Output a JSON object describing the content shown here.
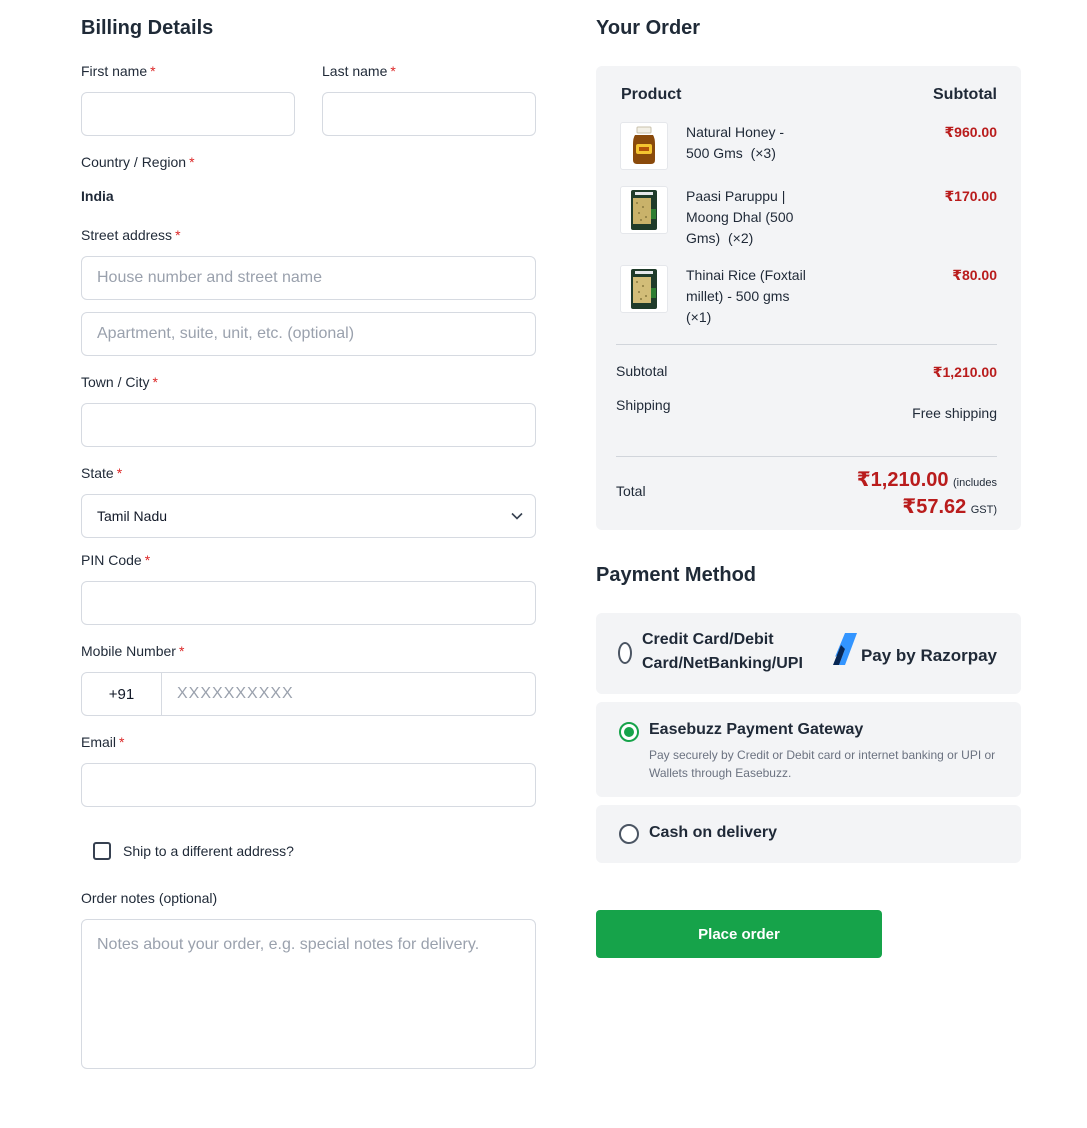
{
  "billing": {
    "title": "Billing Details",
    "first_name_label": "First name",
    "last_name_label": "Last name",
    "country_label": "Country / Region",
    "country_value": "India",
    "street_label": "Street address",
    "street1_placeholder": "House number and street name",
    "street2_placeholder": "Apartment, suite, unit, etc. (optional)",
    "city_label": "Town / City",
    "state_label": "State",
    "state_value": "Tamil Nadu",
    "pin_label": "PIN Code",
    "mobile_label": "Mobile Number",
    "mobile_prefix": "+91",
    "mobile_placeholder": "XXXXXXXXXX",
    "email_label": "Email",
    "ship_different_label": "Ship to a different address?",
    "order_notes_label": "Order notes (optional)",
    "order_notes_placeholder": "Notes about your order, e.g. special notes for delivery.",
    "required_mark": "*"
  },
  "order": {
    "title": "Your Order",
    "product_header": "Product",
    "subtotal_header": "Subtotal",
    "items": [
      {
        "name": "Natural Honey - 500 Gms",
        "qty": "(×3)",
        "price": "₹960.00",
        "image_icon": "honey-jar-icon"
      },
      {
        "name": "Paasi Paruppu | Moong Dhal (500 Gms)",
        "qty": "(×2)",
        "price": "₹170.00",
        "image_icon": "grain-pack-icon"
      },
      {
        "name": "Thinai Rice (Foxtail millet) - 500 gms",
        "qty": "(×1)",
        "price": "₹80.00",
        "image_icon": "grain-pack-icon"
      }
    ],
    "subtotal_label": "Subtotal",
    "subtotal_value": "₹1,210.00",
    "shipping_label": "Shipping",
    "shipping_value": "Free shipping",
    "total_label": "Total",
    "total_value": "₹1,210.00",
    "includes_text": "(includes",
    "tax_value": "₹57.62",
    "tax_suffix": "GST)"
  },
  "payment": {
    "title": "Payment Method",
    "razorpay_label": "Credit Card/Debit Card/NetBanking/UPI",
    "razorpay_brand": "Pay by Razorpay",
    "easebuzz_label": "Easebuzz Payment Gateway",
    "easebuzz_desc": "Pay securely by Credit or Debit card or internet banking or UPI or Wallets through Easebuzz.",
    "cod_label": "Cash on delivery",
    "selected": "easebuzz",
    "place_order": "Place order"
  },
  "colors": {
    "accent_green": "#16a34a",
    "price_red": "#b91c1c",
    "panel_bg": "#f3f4f6"
  }
}
